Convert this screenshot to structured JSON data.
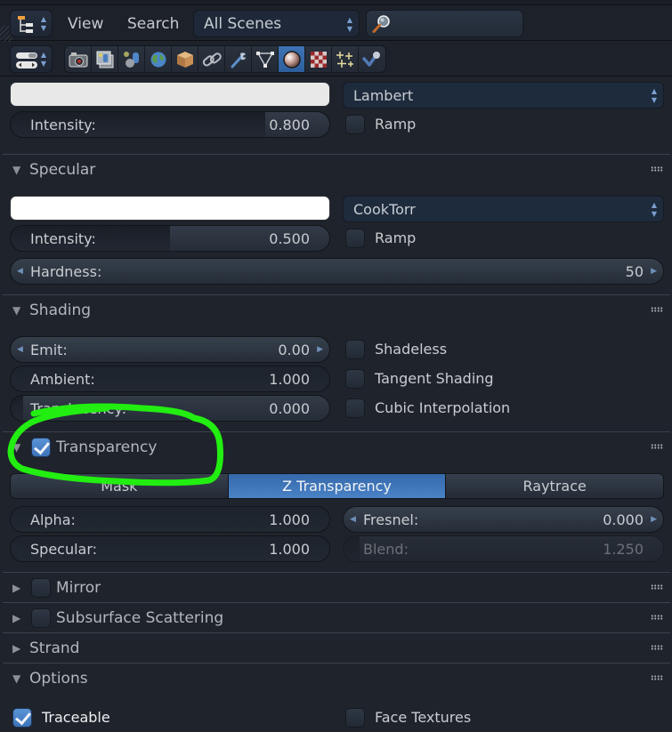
{
  "header": {
    "editor_type_icon": "outliner-icon",
    "menus": [
      {
        "label": "View"
      },
      {
        "label": "Search"
      }
    ],
    "scene_select": {
      "value": "All Scenes"
    },
    "search": {
      "placeholder": "",
      "value": "",
      "icon": "magnifier-icon"
    }
  },
  "toolbar": {
    "view_type_icon": "properties-editor-icon",
    "context_tabs": [
      {
        "name": "render",
        "icon": "camera-icon"
      },
      {
        "name": "render-layers",
        "icon": "render-layers-icon"
      },
      {
        "name": "scene",
        "icon": "scene-icon"
      },
      {
        "name": "world",
        "icon": "world-icon"
      },
      {
        "name": "object",
        "icon": "object-cube-icon"
      },
      {
        "name": "constraints",
        "icon": "chain-link-icon"
      },
      {
        "name": "modifiers",
        "icon": "wrench-icon"
      },
      {
        "name": "data",
        "icon": "mesh-triangle-icon"
      },
      {
        "name": "material",
        "icon": "material-sphere-icon",
        "active": true
      },
      {
        "name": "texture",
        "icon": "checker-texture-icon"
      },
      {
        "name": "particles",
        "icon": "particles-sparkle-icon"
      },
      {
        "name": "physics",
        "icon": "physics-icon"
      }
    ],
    "active_tab": "material"
  },
  "diffuse": {
    "color": "#e8e8e8",
    "shader": "Lambert",
    "intensity": {
      "label": "Intensity:",
      "value": "0.800",
      "fraction": 0.8
    },
    "ramp": {
      "label": "Ramp",
      "checked": false
    }
  },
  "specular": {
    "title": "Specular",
    "expanded": true,
    "color": "#ffffff",
    "shader": "CookTorr",
    "intensity": {
      "label": "Intensity:",
      "value": "0.500",
      "fraction": 0.5
    },
    "ramp": {
      "label": "Ramp",
      "checked": false
    },
    "hardness": {
      "label": "Hardness:",
      "value": "50"
    }
  },
  "shading": {
    "title": "Shading",
    "expanded": true,
    "emit": {
      "label": "Emit:",
      "value": "0.00"
    },
    "ambient": {
      "label": "Ambient:",
      "value": "1.000",
      "fraction": 1.0
    },
    "translucency": {
      "label": "Translucency:",
      "value": "0.000",
      "fraction": 0.0
    },
    "shadeless": {
      "label": "Shadeless",
      "checked": false
    },
    "tangent_shading": {
      "label": "Tangent Shading",
      "checked": false
    },
    "cubic_interpolation": {
      "label": "Cubic Interpolation",
      "checked": false
    }
  },
  "transparency": {
    "title": "Transparency",
    "expanded": true,
    "enabled": true,
    "modes": [
      {
        "label": "Mask"
      },
      {
        "label": "Z Transparency",
        "active": true
      },
      {
        "label": "Raytrace"
      }
    ],
    "alpha": {
      "label": "Alpha:",
      "value": "1.000",
      "fraction": 1.0
    },
    "specular": {
      "label": "Specular:",
      "value": "1.000",
      "fraction": 1.0
    },
    "fresnel": {
      "label": "Fresnel:",
      "value": "0.000"
    },
    "blend": {
      "label": "Blend:",
      "value": "1.250",
      "fraction": 0.05,
      "disabled": true
    }
  },
  "mirror": {
    "title": "Mirror",
    "expanded": false,
    "enabled": false
  },
  "sss": {
    "title": "Subsurface Scattering",
    "expanded": false,
    "enabled": false
  },
  "strand": {
    "title": "Strand",
    "expanded": false
  },
  "options": {
    "title": "Options",
    "expanded": true,
    "traceable": {
      "label": "Traceable",
      "checked": true
    },
    "face_textures": {
      "label": "Face Textures",
      "checked": false
    }
  },
  "annotation": {
    "color": "#22ee11",
    "target": "transparency-panel-header"
  }
}
